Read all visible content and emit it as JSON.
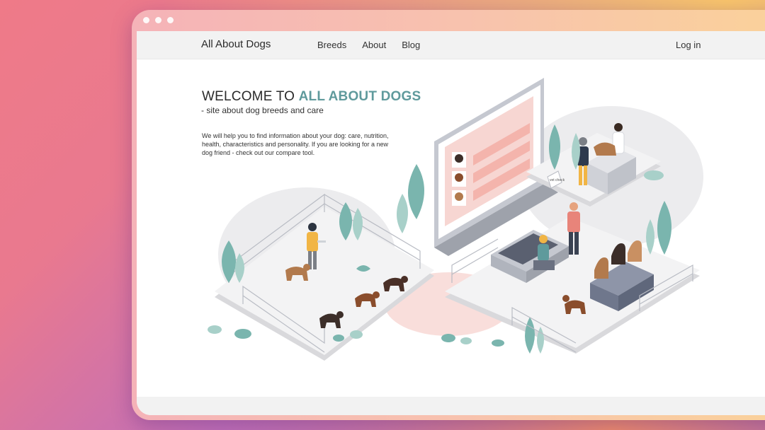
{
  "brand": "All About Dogs",
  "nav": {
    "items": [
      "Breeds",
      "About",
      "Blog"
    ],
    "login": "Log in"
  },
  "hero": {
    "title_plain": "WELCOME TO ",
    "title_accent": "ALL ABOUT DOGS",
    "subtitle": "- site about dog breeds and care",
    "body": "We will help you to find information about your dog: care, nutrition, health, characteristics and personality. If you are looking for a new dog friend - check out our compare tool."
  },
  "illustration": {
    "sign_text": "vet check"
  },
  "colors": {
    "accent": "#5f9a9c",
    "plant": "#7ab5ae",
    "platform": "#d9d9dc",
    "pink": "#f7d6d2"
  }
}
